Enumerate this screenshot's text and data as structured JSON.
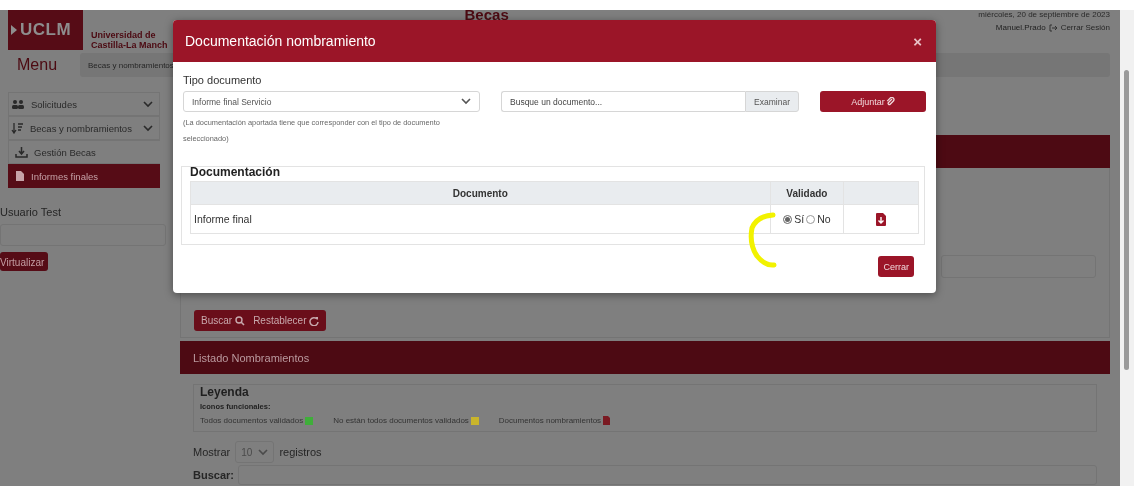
{
  "header": {
    "logo": "UCLM",
    "university": "Universidad de Castilla-La Manch",
    "title": "Becas",
    "date": "miércoles, 20 de septiembre de 2023",
    "user": "Manuel.Prado",
    "logout": "Cerrar Sesión"
  },
  "menu_label": "Menu",
  "breadcrumb": "Becas y nombramientos",
  "sidebar": {
    "items": [
      {
        "label": "Solicitudes",
        "kind": "group",
        "selected": false
      },
      {
        "label": "Becas y nombramientos",
        "kind": "group",
        "selected": false,
        "children": [
          {
            "label": "Gestión Becas",
            "kind": "link",
            "selected": false
          },
          {
            "label": "Informes finales",
            "kind": "link",
            "selected": true
          }
        ]
      }
    ],
    "user_label": "Usuario Test",
    "user_button": "Virtualizar"
  },
  "filter_panel": {
    "buttons": [
      "Buscar",
      "Restablecer"
    ]
  },
  "list_panel": {
    "title": "Listado Nombramientos",
    "legend": {
      "title": "Leyenda",
      "subtitle": "Iconos funcionales:",
      "items": [
        {
          "label": "Todos documentos validados",
          "kind": "swatch",
          "color": "#3fae3a"
        },
        {
          "label": "No están todos documentos validados",
          "kind": "swatch",
          "color": "#c9b52c"
        },
        {
          "label": "Documentos nombramientos",
          "kind": "file"
        }
      ]
    },
    "length": {
      "before": "Mostrar",
      "value": "10",
      "after": "registros"
    },
    "search_label": "Buscar:"
  },
  "modal": {
    "title": "Documentación nombramiento",
    "close": "×",
    "type_label": "Tipo documento",
    "type_value": "Informe final Servicio",
    "hint": "(La documentación aportada tiene que corresponder con el tipo de documento seleccionado)",
    "file_placeholder": "Busque un documento...",
    "browse": "Examinar",
    "attach": "Adjuntar",
    "section_title": "Documentación",
    "table": {
      "columns": [
        "Documento",
        "Validado"
      ],
      "rows": [
        {
          "document": "Informe final",
          "options": [
            {
              "label": "Sí",
              "selected": true
            },
            {
              "label": "No",
              "selected": false
            }
          ]
        }
      ]
    },
    "close_button": "Cerrar"
  }
}
